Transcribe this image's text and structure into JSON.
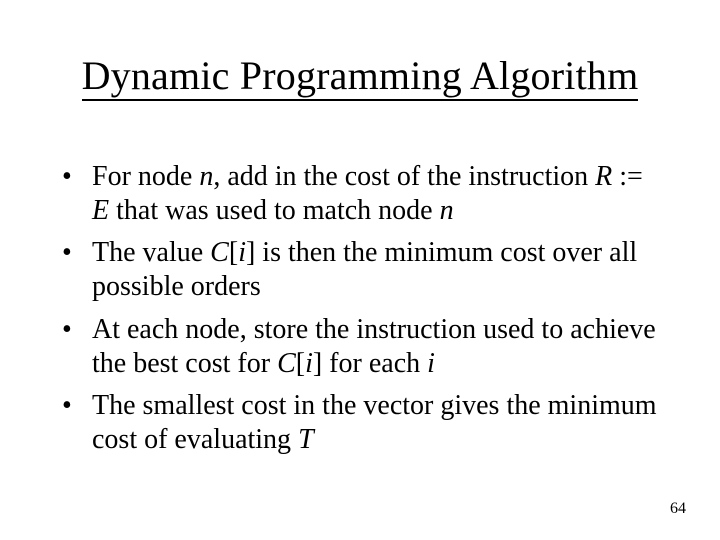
{
  "title": "Dynamic Programming Algorithm",
  "bullets": [
    {
      "pre": "For node ",
      "v1": "n",
      "mid1": ", add in the cost of the instruction ",
      "v2": "R",
      "mid2": " := ",
      "v3": "E",
      "mid3": " that was used to match node ",
      "v4": "n",
      "post": ""
    },
    {
      "pre": "The value ",
      "v1": "C",
      "mid1": "[",
      "v2": "i",
      "mid2": "] is then the minimum cost over all possible orders",
      "v3": "",
      "mid3": "",
      "v4": "",
      "post": ""
    },
    {
      "pre": "At each node, store the instruction used to achieve the best cost for ",
      "v1": "C",
      "mid1": "[",
      "v2": "i",
      "mid2": "] for each ",
      "v3": "i",
      "mid3": "",
      "v4": "",
      "post": ""
    },
    {
      "pre": "The smallest cost in the vector gives the minimum cost of evaluating ",
      "v1": "T",
      "mid1": "",
      "v2": "",
      "mid2": "",
      "v3": "",
      "mid3": "",
      "v4": "",
      "post": ""
    }
  ],
  "page_number": "64"
}
